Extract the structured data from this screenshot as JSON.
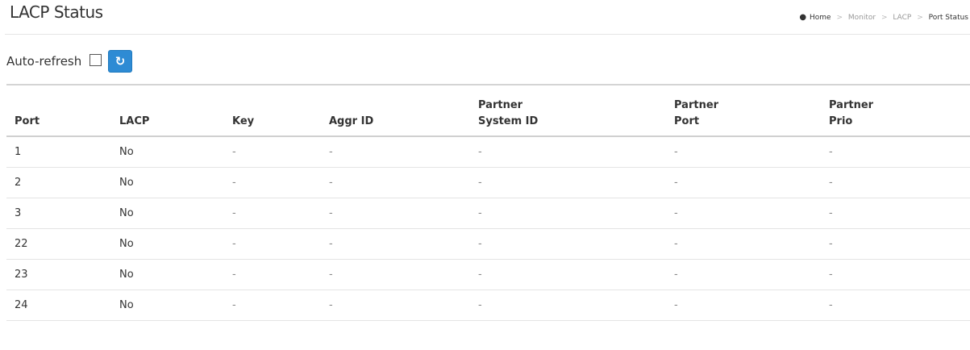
{
  "header": {
    "title": "LACP Status",
    "breadcrumb": {
      "home": "Home",
      "separator": ">",
      "items": [
        "Monitor",
        "LACP",
        "Port Status"
      ]
    }
  },
  "refresh": {
    "auto_refresh_label": "Auto-refresh",
    "auto_refresh_checked": false,
    "refresh_icon": "refresh-icon",
    "refresh_glyph": "↻"
  },
  "table": {
    "columns": [
      {
        "line1": "",
        "line2": "Port"
      },
      {
        "line1": "",
        "line2": "LACP"
      },
      {
        "line1": "",
        "line2": "Key"
      },
      {
        "line1": "",
        "line2": "Aggr ID"
      },
      {
        "line1": "Partner",
        "line2": "System ID"
      },
      {
        "line1": "Partner",
        "line2": "Port"
      },
      {
        "line1": "Partner",
        "line2": "Prio"
      }
    ],
    "rows": [
      {
        "port": "1",
        "lacp": "No",
        "key": "-",
        "aggr_id": "-",
        "partner_system_id": "-",
        "partner_port": "-",
        "partner_prio": "-"
      },
      {
        "port": "2",
        "lacp": "No",
        "key": "-",
        "aggr_id": "-",
        "partner_system_id": "-",
        "partner_port": "-",
        "partner_prio": "-"
      },
      {
        "port": "3",
        "lacp": "No",
        "key": "-",
        "aggr_id": "-",
        "partner_system_id": "-",
        "partner_port": "-",
        "partner_prio": "-"
      },
      {
        "port": "22",
        "lacp": "No",
        "key": "-",
        "aggr_id": "-",
        "partner_system_id": "-",
        "partner_port": "-",
        "partner_prio": "-"
      },
      {
        "port": "23",
        "lacp": "No",
        "key": "-",
        "aggr_id": "-",
        "partner_system_id": "-",
        "partner_port": "-",
        "partner_prio": "-"
      },
      {
        "port": "24",
        "lacp": "No",
        "key": "-",
        "aggr_id": "-",
        "partner_system_id": "-",
        "partner_port": "-",
        "partner_prio": "-"
      }
    ]
  },
  "colors": {
    "accent": "#2e8bd4",
    "text": "#333333",
    "muted": "#999999"
  }
}
